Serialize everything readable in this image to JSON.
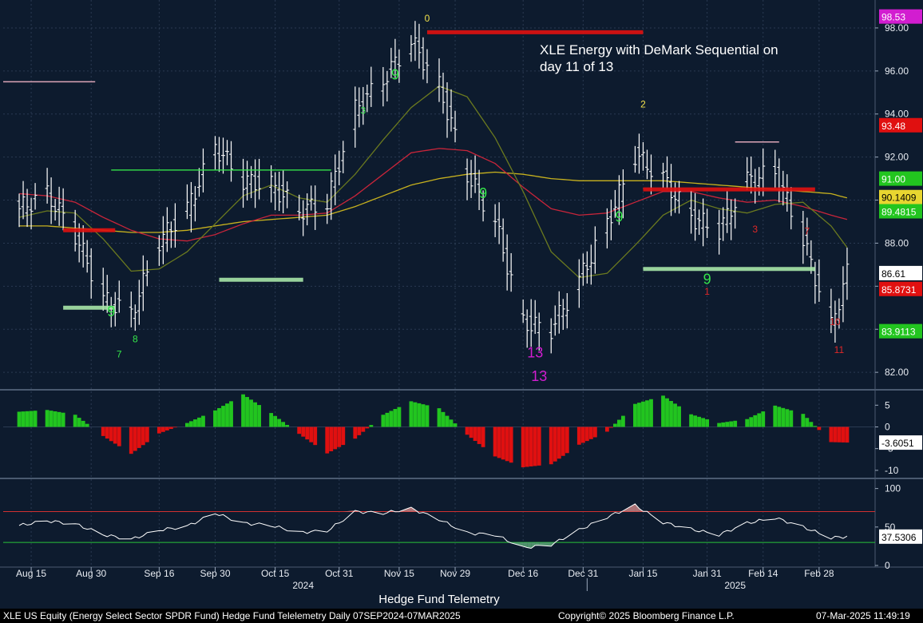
{
  "title_lines": [
    "XLE Energy with DeMark Sequential on",
    "day 11 of 13"
  ],
  "caption": "Hedge Fund Telemetry",
  "footer": {
    "left": "XLE US Equity (Energy Select Sector SPDR Fund) Hedge Fund Telelemetry  Daily 07SEP2024-07MAR2025",
    "center": "Copyright© 2025 Bloomberg Finance L.P.",
    "right": "07-Mar-2025 11:49:19"
  },
  "colors": {
    "background": "#0d1b2e",
    "bar": "#ffffff",
    "ma_short": "#6b7a1f",
    "ma_mid": "#c8253a",
    "ma_long": "#c8b21e",
    "up_hist": "#22c51f",
    "down_hist": "#e01010",
    "buy_count": "#35e64a",
    "sell_count": "#e02828",
    "thirteen": "#d21dd0",
    "zero_count": "#f2e24b"
  },
  "chart_data": [
    {
      "type": "ohlc",
      "name": "price",
      "x": [
        "2024-08-12",
        "2024-08-19",
        "2024-08-26",
        "2024-09-02",
        "2024-09-09",
        "2024-09-16",
        "2024-09-23",
        "2024-09-30",
        "2024-10-07",
        "2024-10-14",
        "2024-10-21",
        "2024-10-28",
        "2024-11-04",
        "2024-11-11",
        "2024-11-18",
        "2024-11-25",
        "2024-12-02",
        "2024-12-09",
        "2024-12-16",
        "2024-12-23",
        "2024-12-30",
        "2025-01-06",
        "2025-01-13",
        "2025-01-20",
        "2025-01-27",
        "2025-02-03",
        "2025-02-10",
        "2025-02-17",
        "2025-02-24",
        "2025-03-03",
        "2025-03-07"
      ],
      "close": [
        89.6,
        90.3,
        88.4,
        85.4,
        84.7,
        88.1,
        89.6,
        92.5,
        90.9,
        90.7,
        89.5,
        89.9,
        94.2,
        95.6,
        97.4,
        95.3,
        91.2,
        89.0,
        84.3,
        84.0,
        86.3,
        88.9,
        92.1,
        91.0,
        89.2,
        88.6,
        90.9,
        91.3,
        88.2,
        84.1,
        86.61
      ],
      "ylim": [
        81.3,
        99.0
      ],
      "y_ticks": [
        82.0,
        84.0,
        86.0,
        88.0,
        90.0,
        92.0,
        94.0,
        96.0,
        98.0
      ],
      "y_tick_labels": [
        "82.00",
        "84.00",
        "86.00",
        "88.00",
        "90.00",
        "92.00",
        "94.00",
        "96.00",
        "98.00"
      ],
      "last_price": 86.61,
      "right_tags": [
        {
          "text": "98.53",
          "value": 98.53,
          "color": "#d21dd0"
        },
        {
          "text": "93.48",
          "value": 93.48,
          "color": "#e01010"
        },
        {
          "text": "91.00",
          "value": 91.0,
          "color": "#22c51f"
        },
        {
          "text": "90.1409",
          "value": 90.1409,
          "color": "#e8d630"
        },
        {
          "text": "89.4815",
          "value": 89.4815,
          "color": "#22c51f"
        },
        {
          "text": "86.61",
          "value": 86.61,
          "color": "#ffffff"
        },
        {
          "text": "85.8731",
          "value": 85.8731,
          "color": "#e01010"
        },
        {
          "text": "83.9113",
          "value": 83.9113,
          "color": "#22c51f"
        }
      ],
      "ma_short": [
        89.2,
        89.5,
        89.4,
        88.2,
        86.7,
        86.8,
        87.6,
        88.9,
        90.2,
        90.7,
        90.1,
        89.9,
        91.2,
        92.8,
        94.3,
        95.3,
        94.8,
        92.9,
        90.4,
        87.6,
        86.4,
        86.6,
        87.9,
        89.3,
        90.0,
        89.6,
        89.4,
        89.8,
        89.9,
        88.8,
        87.8
      ],
      "ma_mid": [
        90.3,
        90.2,
        89.9,
        89.2,
        88.6,
        88.2,
        88.1,
        88.4,
        88.9,
        89.3,
        89.3,
        89.4,
        90.2,
        91.2,
        92.2,
        92.4,
        92.3,
        91.7,
        90.6,
        89.6,
        89.3,
        89.4,
        89.9,
        90.4,
        90.4,
        90.1,
        89.9,
        90.0,
        89.7,
        89.3,
        89.1
      ],
      "ma_long": [
        88.8,
        88.8,
        88.7,
        88.6,
        88.5,
        88.5,
        88.6,
        88.8,
        89.0,
        89.1,
        89.2,
        89.3,
        89.7,
        90.2,
        90.7,
        91.0,
        91.2,
        91.3,
        91.2,
        91.0,
        90.9,
        90.9,
        90.9,
        90.9,
        90.8,
        90.7,
        90.6,
        90.5,
        90.4,
        90.3,
        90.1
      ],
      "counts": [
        {
          "x": "2024-09-04",
          "y": 84.6,
          "text": "9",
          "kind": "buy"
        },
        {
          "x": "2024-09-10",
          "y": 83.4,
          "text": "8",
          "kind": "buy"
        },
        {
          "x": "2024-09-06",
          "y": 82.7,
          "text": "7",
          "kind": "buy"
        },
        {
          "x": "2024-11-06",
          "y": 94.0,
          "text": "3",
          "kind": "buy"
        },
        {
          "x": "2024-11-14",
          "y": 95.6,
          "text": "9",
          "kind": "buy"
        },
        {
          "x": "2024-11-22",
          "y": 98.3,
          "text": "0",
          "kind": "zero"
        },
        {
          "x": "2024-12-06",
          "y": 90.1,
          "text": "9",
          "kind": "buy"
        },
        {
          "x": "2024-12-20",
          "y": 81.6,
          "text": "13",
          "kind": "thirteen"
        },
        {
          "x": "2024-12-19",
          "y": 82.7,
          "text": "13",
          "kind": "thirteen"
        },
        {
          "x": "2025-01-09",
          "y": 89.0,
          "text": "9",
          "kind": "buy"
        },
        {
          "x": "2025-01-15",
          "y": 94.3,
          "text": "2",
          "kind": "zero"
        },
        {
          "x": "2025-01-31",
          "y": 86.1,
          "text": "9",
          "kind": "buy"
        },
        {
          "x": "2025-01-31",
          "y": 85.6,
          "text": "1",
          "kind": "sell"
        },
        {
          "x": "2025-02-12",
          "y": 88.5,
          "text": "3",
          "kind": "sell"
        },
        {
          "x": "2025-02-25",
          "y": 88.4,
          "text": "7",
          "kind": "sell"
        },
        {
          "x": "2025-03-04",
          "y": 84.2,
          "text": "10",
          "kind": "sell"
        },
        {
          "x": "2025-03-05",
          "y": 82.9,
          "text": "11",
          "kind": "sell"
        }
      ],
      "levels": [
        {
          "x0": "2024-08-08",
          "x1": "2024-08-31",
          "y": 95.5,
          "color": "#f4b6c8"
        },
        {
          "x0": "2024-08-23",
          "x1": "2024-09-05",
          "y": 88.6,
          "color": "#e01010"
        },
        {
          "x0": "2024-08-23",
          "x1": "2024-09-05",
          "y": 85.0,
          "color": "#a8e6a8"
        },
        {
          "x0": "2024-09-04",
          "x1": "2024-10-29",
          "y": 91.4,
          "color": "#35e64a"
        },
        {
          "x0": "2024-10-01",
          "x1": "2024-10-22",
          "y": 86.3,
          "color": "#a8e6a8"
        },
        {
          "x0": "2024-11-22",
          "x1": "2025-01-15",
          "y": 97.8,
          "color": "#e01010"
        },
        {
          "x0": "2025-01-15",
          "x1": "2025-02-27",
          "y": 90.5,
          "color": "#e01010"
        },
        {
          "x0": "2025-01-15",
          "x1": "2025-02-27",
          "y": 86.8,
          "color": "#a8e6a8"
        },
        {
          "x0": "2025-02-07",
          "x1": "2025-02-18",
          "y": 92.7,
          "color": "#f4b6c8"
        }
      ]
    },
    {
      "type": "bar",
      "name": "oscillator",
      "x": [
        "2024-08-12",
        "2024-08-19",
        "2024-08-26",
        "2024-09-02",
        "2024-09-09",
        "2024-09-16",
        "2024-09-23",
        "2024-09-30",
        "2024-10-07",
        "2024-10-14",
        "2024-10-21",
        "2024-10-28",
        "2024-11-04",
        "2024-11-11",
        "2024-11-18",
        "2024-11-25",
        "2024-12-02",
        "2024-12-09",
        "2024-12-16",
        "2024-12-23",
        "2024-12-30",
        "2025-01-06",
        "2025-01-13",
        "2025-01-20",
        "2025-01-27",
        "2025-02-03",
        "2025-02-10",
        "2025-02-17",
        "2025-02-24",
        "2025-03-03",
        "2025-03-07"
      ],
      "values": [
        3.5,
        3.9,
        2.8,
        -2.1,
        -6.2,
        -1.5,
        0.9,
        3.8,
        7.5,
        3.2,
        -1.6,
        -6.1,
        -2.7,
        2.8,
        5.9,
        4.3,
        -1.8,
        -6.8,
        -9.3,
        -8.6,
        -4.1,
        -1.1,
        5.3,
        7.2,
        2.9,
        0.9,
        1.8,
        4.9,
        3.0,
        -3.5,
        -3.6051
      ],
      "ylim": [
        -11.5,
        8.0
      ],
      "y_ticks": [
        5,
        0,
        -5,
        -10
      ],
      "y_tick_labels": [
        "5",
        "0",
        "-5",
        "-10"
      ],
      "last_value": "-3.6051"
    },
    {
      "type": "line",
      "name": "rsi",
      "x": [
        "2024-08-12",
        "2024-08-19",
        "2024-08-26",
        "2024-09-02",
        "2024-09-09",
        "2024-09-16",
        "2024-09-23",
        "2024-09-30",
        "2024-10-07",
        "2024-10-14",
        "2024-10-21",
        "2024-10-28",
        "2024-11-04",
        "2024-11-11",
        "2024-11-18",
        "2024-11-25",
        "2024-12-02",
        "2024-12-09",
        "2024-12-16",
        "2024-12-23",
        "2024-12-30",
        "2025-01-06",
        "2025-01-13",
        "2025-01-20",
        "2025-01-27",
        "2025-02-03",
        "2025-02-10",
        "2025-02-17",
        "2025-02-24",
        "2025-03-03",
        "2025-03-07"
      ],
      "values": [
        52,
        58,
        54,
        40,
        34,
        46,
        51,
        68,
        55,
        52,
        43,
        45,
        70,
        68,
        74,
        60,
        42,
        40,
        23,
        27,
        46,
        63,
        78,
        56,
        47,
        40,
        55,
        62,
        50,
        36,
        37.53
      ],
      "ylim": [
        0,
        110
      ],
      "upper": 70,
      "lower": 30,
      "y_ticks": [
        100,
        50,
        0
      ],
      "y_tick_labels": [
        "100",
        "50",
        "0"
      ],
      "last_value": "37.5306"
    }
  ],
  "x_axis": {
    "ticks": [
      {
        "date": "2024-08-15",
        "label": "Aug 15"
      },
      {
        "date": "2024-08-30",
        "label": "Aug 30"
      },
      {
        "date": "2024-09-16",
        "label": "Sep 16"
      },
      {
        "date": "2024-09-30",
        "label": "Sep 30"
      },
      {
        "date": "2024-10-15",
        "label": "Oct 15"
      },
      {
        "date": "2024-10-31",
        "label": "Oct 31"
      },
      {
        "date": "2024-11-15",
        "label": "Nov 15"
      },
      {
        "date": "2024-11-29",
        "label": "Nov 29"
      },
      {
        "date": "2024-12-16",
        "label": "Dec 16"
      },
      {
        "date": "2024-12-31",
        "label": "Dec 31"
      },
      {
        "date": "2025-01-15",
        "label": "Jan 15"
      },
      {
        "date": "2025-01-31",
        "label": "Jan 31"
      },
      {
        "date": "2025-02-14",
        "label": "Feb 14"
      },
      {
        "date": "2025-02-28",
        "label": "Feb 28"
      }
    ],
    "years": [
      {
        "date": "2024-10-22",
        "label": "2024"
      },
      {
        "date": "2025-02-07",
        "label": "2025"
      }
    ]
  }
}
